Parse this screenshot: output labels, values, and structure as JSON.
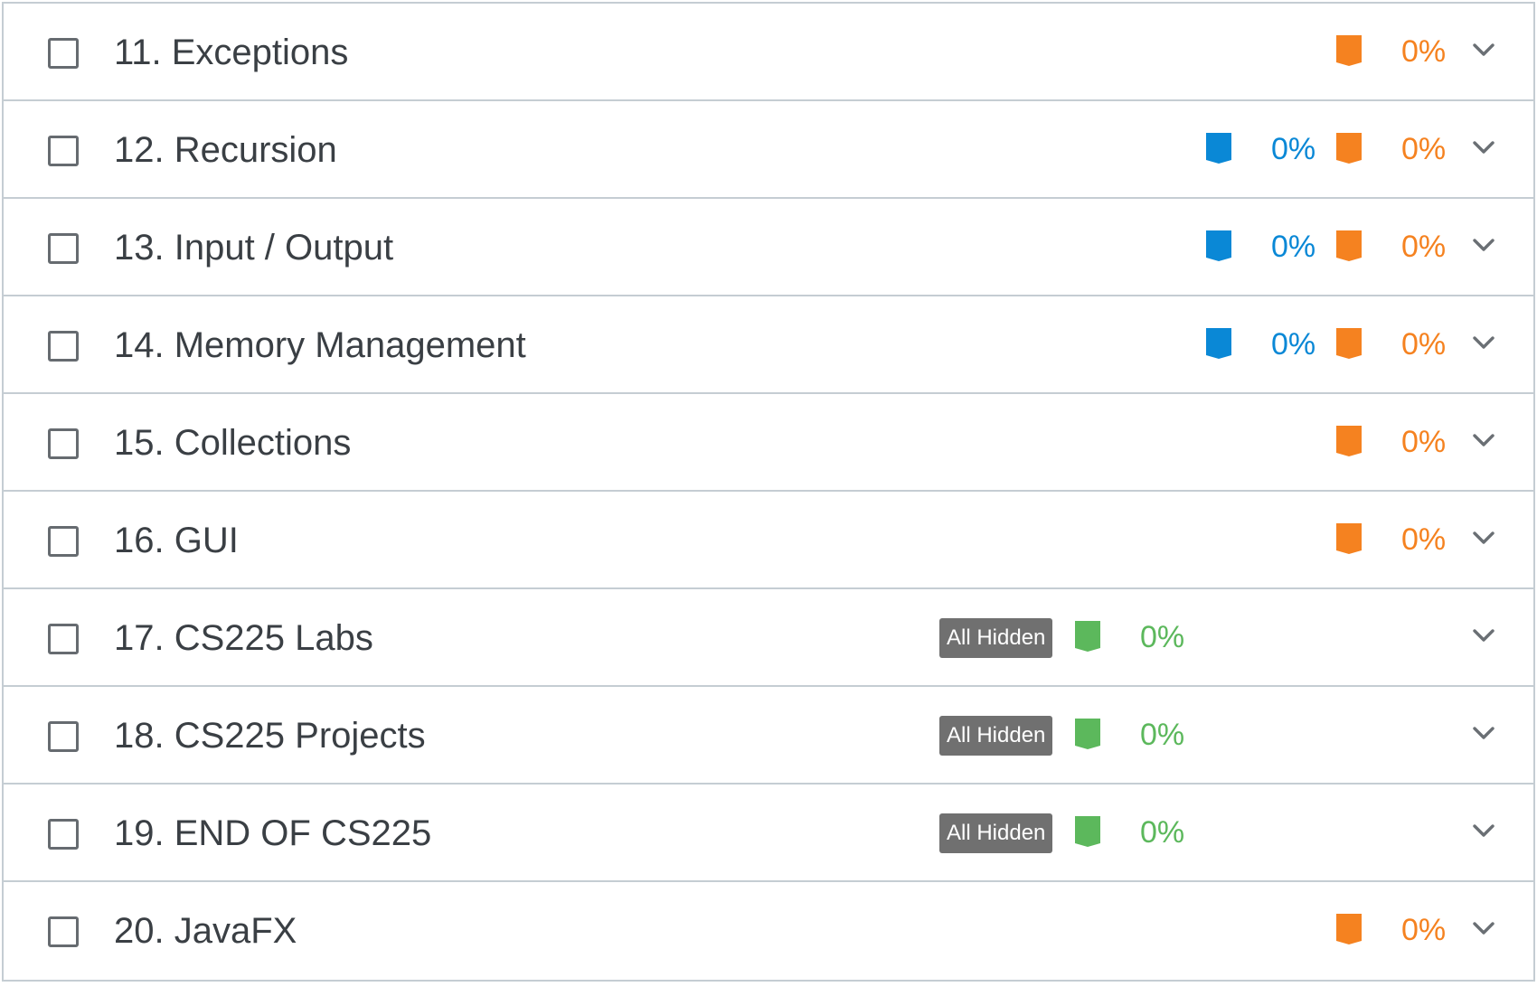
{
  "colors": {
    "blue": "#0a88d6",
    "orange": "#f58220",
    "green": "#5cb85c",
    "badge_bg": "#707070",
    "title_text": "#3a3f44",
    "border": "#c5cdd3"
  },
  "icons": {
    "flag": "bookmark-flag-icon",
    "expand": "chevron-down-icon",
    "check": "checkbox-icon"
  },
  "rows": [
    {
      "title": "11. Exceptions",
      "blue_pct": null,
      "orange_pct": "0%",
      "hidden_badge": null,
      "green_pct": null
    },
    {
      "title": "12. Recursion",
      "blue_pct": "0%",
      "orange_pct": "0%",
      "hidden_badge": null,
      "green_pct": null
    },
    {
      "title": "13. Input / Output",
      "blue_pct": "0%",
      "orange_pct": "0%",
      "hidden_badge": null,
      "green_pct": null
    },
    {
      "title": "14. Memory Management",
      "blue_pct": "0%",
      "orange_pct": "0%",
      "hidden_badge": null,
      "green_pct": null
    },
    {
      "title": "15. Collections",
      "blue_pct": null,
      "orange_pct": "0%",
      "hidden_badge": null,
      "green_pct": null
    },
    {
      "title": "16. GUI",
      "blue_pct": null,
      "orange_pct": "0%",
      "hidden_badge": null,
      "green_pct": null
    },
    {
      "title": "17. CS225 Labs",
      "blue_pct": null,
      "orange_pct": null,
      "hidden_badge": "All Hidden",
      "green_pct": "0%"
    },
    {
      "title": "18. CS225 Projects",
      "blue_pct": null,
      "orange_pct": null,
      "hidden_badge": "All Hidden",
      "green_pct": "0%"
    },
    {
      "title": "19. END OF CS225",
      "blue_pct": null,
      "orange_pct": null,
      "hidden_badge": "All Hidden",
      "green_pct": "0%"
    },
    {
      "title": "20. JavaFX",
      "blue_pct": null,
      "orange_pct": "0%",
      "hidden_badge": null,
      "green_pct": null
    }
  ]
}
